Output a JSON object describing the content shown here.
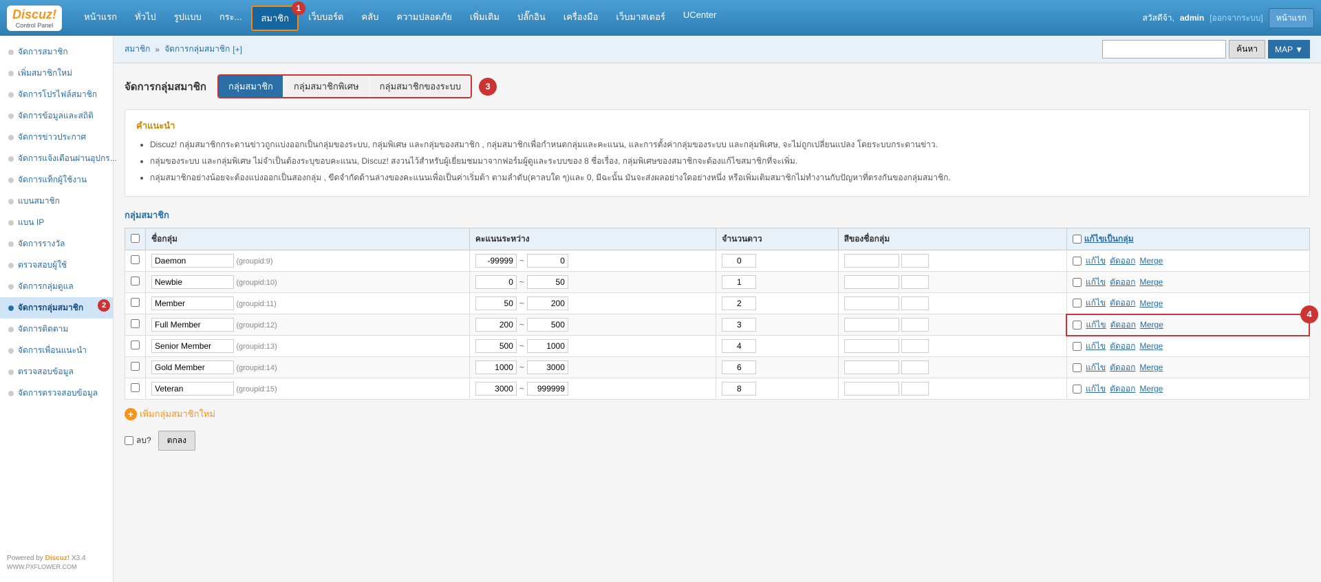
{
  "logo": {
    "name": "Discuz!",
    "sub": "Control Panel"
  },
  "topnav": {
    "items": [
      {
        "label": "หน้าแรก",
        "active": false
      },
      {
        "label": "ทั่วไป",
        "active": false
      },
      {
        "label": "รูปแบบ",
        "active": false
      },
      {
        "label": "กระ...",
        "active": false
      },
      {
        "label": "สมาชิก",
        "active": true
      },
      {
        "label": "เว็บบอร์ด",
        "active": false
      },
      {
        "label": "คลับ",
        "active": false
      },
      {
        "label": "ความปลอดภัย",
        "active": false
      },
      {
        "label": "เพิ่มเติม",
        "active": false
      },
      {
        "label": "ปลั๊กอิน",
        "active": false
      },
      {
        "label": "เครื่องมือ",
        "active": false
      },
      {
        "label": "เว็บมาสเตอร์",
        "active": false
      },
      {
        "label": "UCenter",
        "active": false
      }
    ],
    "greeting": "สวัสดีจ้า,",
    "username": "admin",
    "logout": "[ออกจากระบบ]",
    "front_btn": "หน้าแรก"
  },
  "breadcrumb": {
    "parts": [
      "สมาชิก",
      "»",
      "จัดการกลุ่มสมาชิก",
      "[+]"
    ]
  },
  "search": {
    "placeholder": "",
    "search_btn": "ค้นหา",
    "map_btn": "MAP ▼"
  },
  "sidebar": {
    "items": [
      {
        "label": "จัดการสมาชิก",
        "active": false
      },
      {
        "label": "เพิ่มสมาชิกใหม่",
        "active": false
      },
      {
        "label": "จัดการโปรไฟล์สมาชิก",
        "active": false
      },
      {
        "label": "จัดการข้อมูลและสถิติ",
        "active": false
      },
      {
        "label": "จัดการข่าวประกาศ",
        "active": false
      },
      {
        "label": "จัดการแจ้งเตือนผ่านอุปกร...",
        "active": false
      },
      {
        "label": "จัดการแท็กผู้ใช้งาน",
        "active": false
      },
      {
        "label": "แบนสมาชิก",
        "active": false
      },
      {
        "label": "แบน IP",
        "active": false
      },
      {
        "label": "จัดการรางวัล",
        "active": false
      },
      {
        "label": "ตรวจสอบผู้ใช้",
        "active": false
      },
      {
        "label": "จัดการกลุ่มดูแล",
        "active": false
      },
      {
        "label": "จัดการกลุ่มสมาชิก",
        "active": true
      },
      {
        "label": "จัดการติดตาม",
        "active": false
      },
      {
        "label": "จัดการเพื่อนแนะนำ",
        "active": false
      },
      {
        "label": "ตรวจสอบข้อมูล",
        "active": false
      },
      {
        "label": "จัดการตรวจสอบข้อมูล",
        "active": false
      }
    ],
    "powered": "Powered by",
    "discuz": "Discuz!",
    "version": "X3.4"
  },
  "page": {
    "title": "จัดการกลุ่มสมาชิก",
    "tabs": [
      {
        "label": "กลุ่มสมาชิก",
        "active": true
      },
      {
        "label": "กลุ่มสมาชิกพิเศษ",
        "active": false
      },
      {
        "label": "กลุ่มสมาชิกของระบบ",
        "active": false
      }
    ],
    "badge3": "3"
  },
  "info": {
    "title": "คำแนะนำ",
    "bullets": [
      "Discuz! กลุ่มสมาชิกกระดานข่าวถูกแบ่งออกเป็นกลุ่มของระบบ, กลุ่มพิเศษ และกลุ่มของสมาชิก , กลุ่มสมาชิกเพื่อกำหนดกลุ่มและคะแนน, และการตั้งค่ากลุ่มของระบบ และกลุ่มพิเศษ, จะไม่ถูกเปลี่ยนแปลง โดยระบบกระดานข่าว.",
      "กลุ่มของระบบ และกลุ่มพิเศษ ไม่จำเป็นต้องระบุขอบคะแนน, Discuz! สงวนไว้สำหรับผู้เยี่ยมชมมาจากฟอร์มผู้ดูและระบบของ 8 ชื่อเรื่อง, กลุ่มพิเศษของสมาชิกจะต้องแก้ไขสมาชิกที่จะเพิ่ม.",
      "กลุ่มสมาชิกอย่างน้อยจะต้องแบ่งออกเป็นสองกลุ่ม , ขีดจำกัดด้านล่างของคะแนนเพื่อเป็นค่าเริ่มต้า ตามลำดับ(คาลบใด ๆ)และ 0, มีฉะนั้น มันจะส่งผลอย่างใดอย่างหนึ่ง หรือเพิ่มเติมสมาชิกไม่ทำงานกับปัญหาที่ตรงกันของกลุ่มสมาชิก."
    ]
  },
  "section": {
    "title": "กลุ่มสมาชิก"
  },
  "table": {
    "headers": {
      "checkbox": "",
      "name": "ชื่อกลุ่ม",
      "range": "คะแนนระหว่าง",
      "stars": "จำนวนดาว",
      "color": "สีของชื่อกลุ่ม",
      "edit": "แก้ไขเป็นกลุ่ม"
    },
    "rows": [
      {
        "id": "groupid:9",
        "name": "Daemon",
        "range_min": "-99999",
        "range_max": "0",
        "stars": "0",
        "color": "",
        "small": ""
      },
      {
        "id": "groupid:10",
        "name": "Newbie",
        "range_min": "0",
        "range_max": "50",
        "stars": "1",
        "color": "",
        "small": ""
      },
      {
        "id": "groupid:11",
        "name": "Member",
        "range_min": "50",
        "range_max": "200",
        "stars": "2",
        "color": "",
        "small": ""
      },
      {
        "id": "groupid:12",
        "name": "Full Member",
        "range_min": "200",
        "range_max": "500",
        "stars": "3",
        "color": "",
        "small": ""
      },
      {
        "id": "groupid:13",
        "name": "Senior Member",
        "range_min": "500",
        "range_max": "1000",
        "stars": "4",
        "color": "",
        "small": ""
      },
      {
        "id": "groupid:14",
        "name": "Gold Member",
        "range_min": "1000",
        "range_max": "3000",
        "stars": "6",
        "color": "",
        "small": ""
      },
      {
        "id": "groupid:15",
        "name": "Veteran",
        "range_min": "3000",
        "range_max": "999999",
        "stars": "8",
        "color": "",
        "small": ""
      }
    ],
    "actions": {
      "edit": "แก้ไข",
      "delete": "ตัดออก",
      "merge": "Merge"
    }
  },
  "add_btn": "เพิ่มกลุ่มสมาชิกใหม่",
  "bottom": {
    "delete_label": "ลบ?",
    "confirm_btn": "ตกลง"
  },
  "badges": {
    "b1": "1",
    "b2": "2",
    "b3": "3",
    "b4": "4"
  }
}
